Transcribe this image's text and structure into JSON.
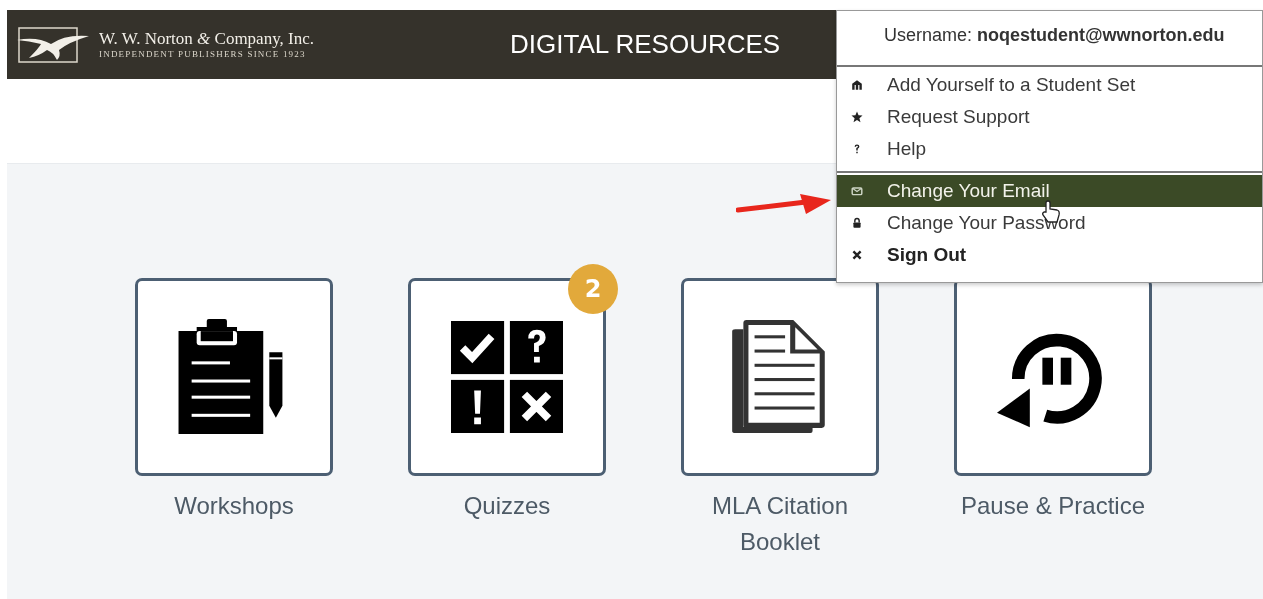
{
  "header": {
    "publisher": "W. W. Norton *&* Company, Inc.",
    "tagline": "INDEPENDENT PUBLISHERS SINCE 1923",
    "title": "DIGITAL RESOURCES"
  },
  "user_menu": {
    "username": "Username: **noqestudent@wwnorton.edu**",
    "sections": [
      [
        {
          "kind": "student-set",
          "label": "Add Yourself to a Student Set",
          "selected": false,
          "bold": false
        },
        {
          "kind": "support",
          "label": "Request Support",
          "selected": false,
          "bold": false
        },
        {
          "kind": "help",
          "label": "Help",
          "selected": false,
          "bold": false
        }
      ],
      [
        {
          "kind": "email",
          "label": "Change Your Email",
          "selected": true,
          "bold": false
        },
        {
          "kind": "password",
          "label": "Change Your Password",
          "selected": false,
          "bold": false
        },
        {
          "kind": "sign-out",
          "label": "Sign Out",
          "selected": false,
          "bold": true
        }
      ]
    ]
  },
  "tiles": [
    {
      "kind": "workshops",
      "label": "Workshops"
    },
    {
      "kind": "quizzes",
      "label": "Quizzes",
      "badge": "2"
    },
    {
      "kind": "booklet",
      "label": "MLA Citation Booklet"
    },
    {
      "kind": "pause",
      "label": "Pause & Practice"
    }
  ]
}
